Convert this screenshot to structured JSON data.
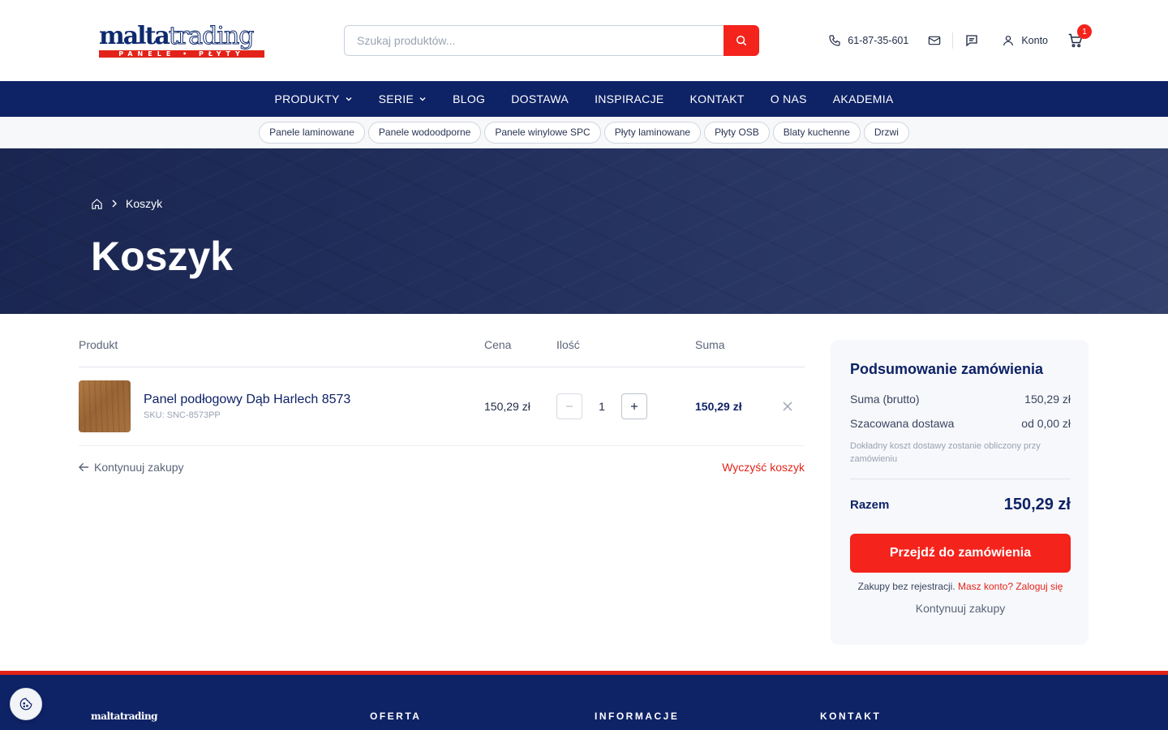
{
  "header": {
    "logo": {
      "brand_main": "malta",
      "brand_accent": "trading",
      "tagline": "PANELE • PŁYTY"
    },
    "search": {
      "placeholder": "Szukaj produktów..."
    },
    "phone": "61-87-35-601",
    "account_label": "Konto",
    "cart_count": "1"
  },
  "nav": {
    "items": [
      {
        "label": "PRODUKTY",
        "dropdown": true
      },
      {
        "label": "SERIE",
        "dropdown": true
      },
      {
        "label": "BLOG"
      },
      {
        "label": "DOSTAWA"
      },
      {
        "label": "INSPIRACJE"
      },
      {
        "label": "KONTAKT"
      },
      {
        "label": "O NAS"
      },
      {
        "label": "AKADEMIA"
      }
    ]
  },
  "categories": [
    "Panele laminowane",
    "Panele wodoodporne",
    "Panele winylowe SPC",
    "Płyty laminowane",
    "Płyty OSB",
    "Blaty kuchenne",
    "Drzwi"
  ],
  "hero": {
    "breadcrumb_current": "Koszyk",
    "title": "Koszyk"
  },
  "cart": {
    "columns": {
      "product": "Produkt",
      "price": "Cena",
      "qty": "Ilość",
      "total": "Suma"
    },
    "items": [
      {
        "name": "Panel podłogowy Dąb Harlech 8573",
        "sku": "SKU: SNC-8573PP",
        "price": "150,29 zł",
        "qty": "1",
        "total": "150,29 zł"
      }
    ],
    "continue_label": "Kontynuuj zakupy",
    "clear_label": "Wyczyść koszyk"
  },
  "summary": {
    "title": "Podsumowanie zamówienia",
    "subtotal_label": "Suma (brutto)",
    "subtotal_value": "150,29 zł",
    "shipping_label": "Szacowana dostawa",
    "shipping_value": "od 0,00 zł",
    "shipping_note": "Dokładny koszt dostawy zostanie obliczony przy zamówieniu",
    "total_label": "Razem",
    "total_value": "150,29 zł",
    "checkout_label": "Przejdź do zamówienia",
    "guest_text": "Zakupy bez rejestracji.",
    "login_link": "Masz konto? Zaloguj się",
    "continue_label": "Kontynuuj zakupy"
  },
  "footer": {
    "logo": "maltatrading",
    "headings": [
      "OFERTA",
      "INFORMACJE",
      "KONTAKT"
    ]
  },
  "colors": {
    "navy": "#0e2266",
    "red": "#f4231c"
  }
}
